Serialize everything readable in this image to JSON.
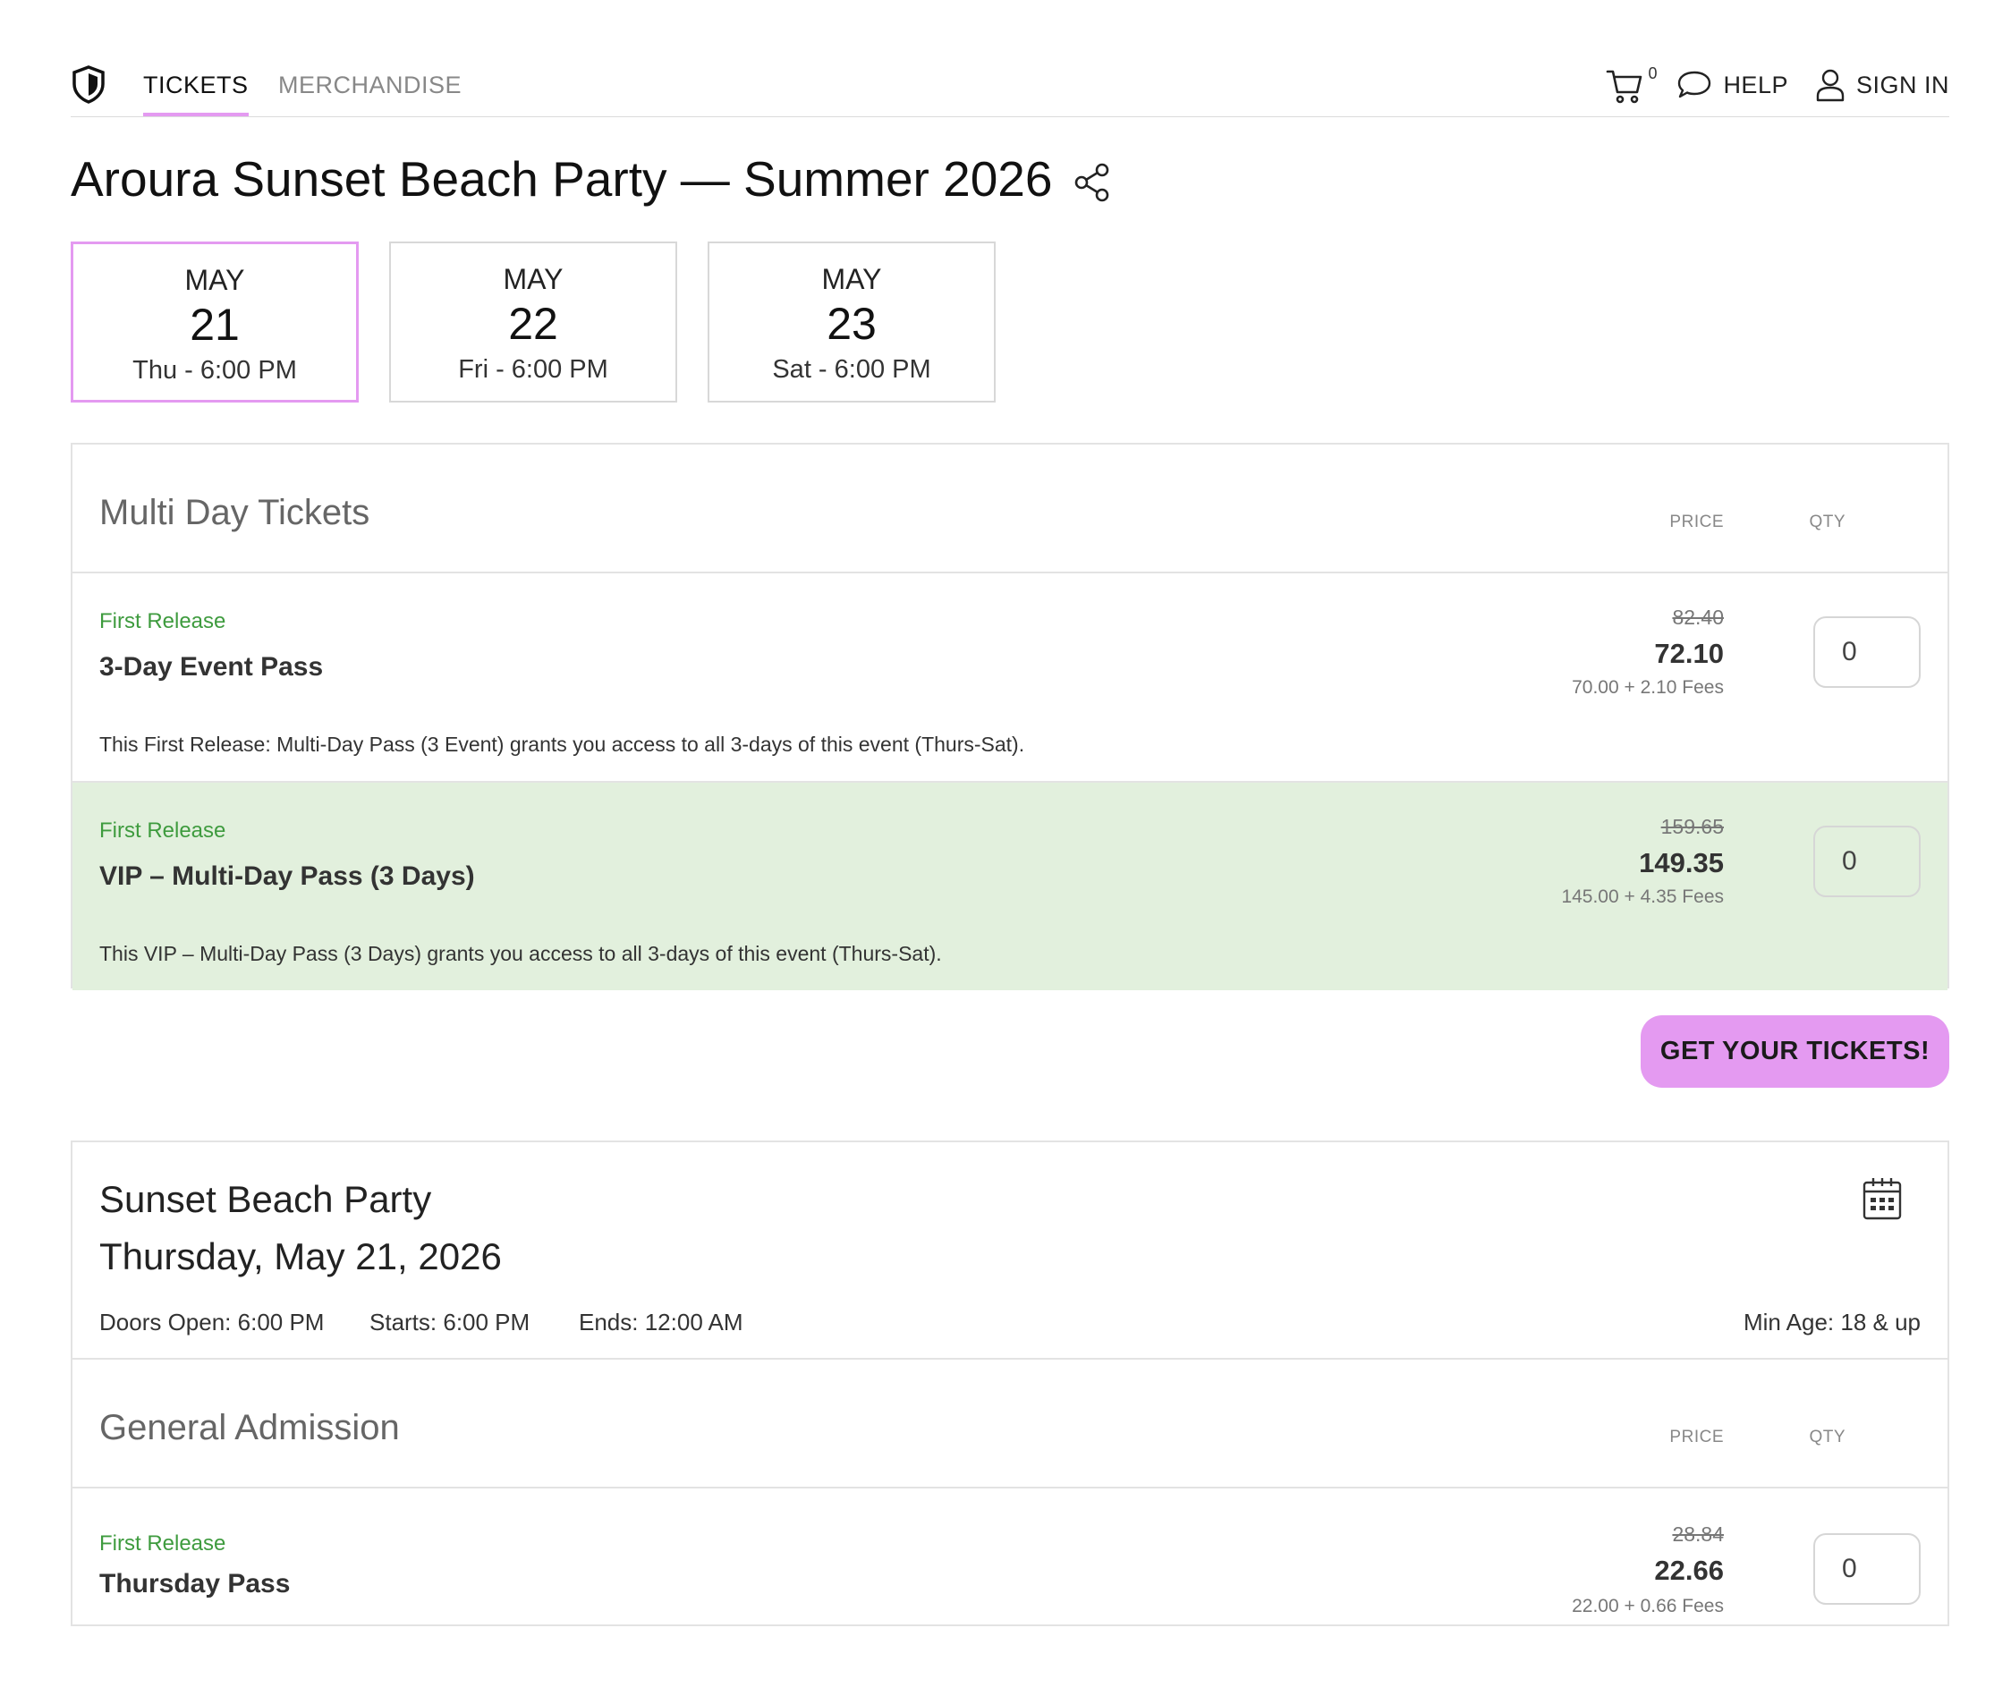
{
  "nav": {
    "tabs": [
      {
        "label": "TICKETS",
        "active": true
      },
      {
        "label": "MERCHANDISE",
        "active": false
      }
    ],
    "cart_count": "0",
    "help_label": "HELP",
    "signin_label": "SIGN IN"
  },
  "event": {
    "title": "Aroura Sunset Beach Party — Summer 2026"
  },
  "dates": [
    {
      "month": "MAY",
      "day": "21",
      "time": "Thu - 6:00 PM",
      "selected": true
    },
    {
      "month": "MAY",
      "day": "22",
      "time": "Fri - 6:00 PM",
      "selected": false
    },
    {
      "month": "MAY",
      "day": "23",
      "time": "Sat - 6:00 PM",
      "selected": false
    }
  ],
  "multi_day": {
    "heading": "Multi Day Tickets",
    "price_col": "PRICE",
    "qty_col": "QTY",
    "tickets": [
      {
        "release": "First Release",
        "name": "3-Day Event Pass",
        "old_price": "82.40",
        "price": "72.10",
        "fees": "70.00 + 2.10 Fees",
        "qty": "0",
        "description": "This First Release: Multi-Day Pass (3 Event) grants you access to all 3-days of this event (Thurs-Sat)."
      },
      {
        "release": "First Release",
        "name": "VIP – Multi-Day Pass (3 Days)",
        "old_price": "159.65",
        "price": "149.35",
        "fees": "145.00 + 4.35 Fees",
        "qty": "0",
        "description": "This VIP – Multi-Day Pass (3 Days) grants you access to all 3-days of this event (Thurs-Sat)."
      }
    ]
  },
  "cta_label": "GET YOUR TICKETS!",
  "event_day": {
    "name": "Sunset Beach Party",
    "date": "Thursday, May 21, 2026",
    "doors": "Doors Open: 6:00 PM",
    "starts": "Starts: 6:00 PM",
    "ends": "Ends: 12:00 AM",
    "min_age": "Min Age: 18 & up"
  },
  "general_admission": {
    "heading": "General Admission",
    "price_col": "PRICE",
    "qty_col": "QTY",
    "tickets": [
      {
        "release": "First Release",
        "name": "Thursday Pass",
        "old_price": "28.84",
        "price": "22.66",
        "fees": "22.00 + 0.66 Fees",
        "qty": "0"
      }
    ]
  },
  "colors": {
    "accent": "#e49af1",
    "release_green": "#3e9b3e",
    "highlight_row": "#e2f0dd"
  }
}
